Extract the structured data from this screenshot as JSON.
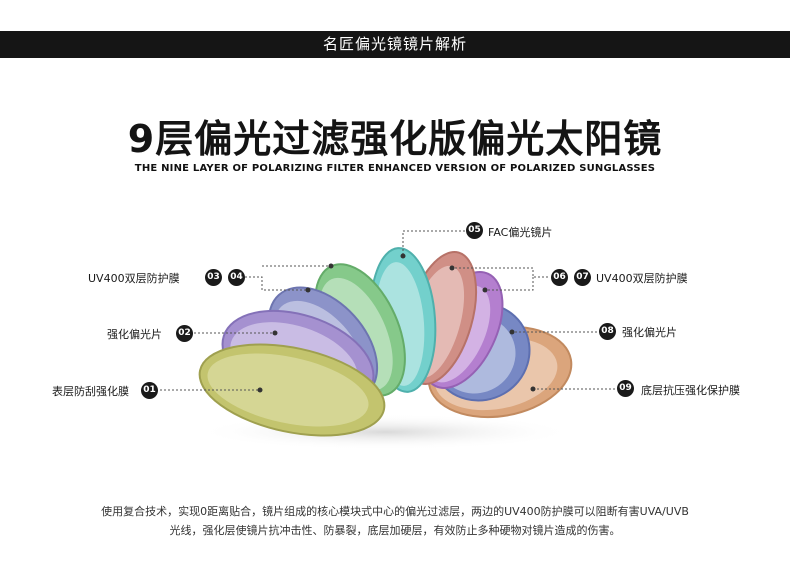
{
  "header": {
    "title": "名匠偏光镜镜片解析"
  },
  "main_title": "9层偏光过滤强化版偏光太阳镜",
  "subtitle": "THE NINE LAYER OF POLARIZING FILTER ENHANCED VERSION OF POLARIZED SUNGLASSES",
  "layers": [
    {
      "num": "01",
      "name": "表层防刮强化膜",
      "color": "#c3c46e"
    },
    {
      "num": "02",
      "name": "强化偏光片",
      "color": "#a591d0"
    },
    {
      "num": "03",
      "name": "UV400双层防护膜",
      "color": "#8c93c9"
    },
    {
      "num": "04",
      "name": "UV400双层防护膜",
      "color": "#86c98a"
    },
    {
      "num": "05",
      "name": "FAC偏光镜片",
      "color": "#73d0cc"
    },
    {
      "num": "06",
      "name": "UV400双层防护膜",
      "color": "#d08f86"
    },
    {
      "num": "07",
      "name": "UV400双层防护膜",
      "color": "#b47fcf"
    },
    {
      "num": "08",
      "name": "强化偏光片",
      "color": "#7788c4"
    },
    {
      "num": "09",
      "name": "底层抗压强化保护膜",
      "color": "#dba57c"
    }
  ],
  "callouts": {
    "label_01": "表层防刮强化膜",
    "label_02": "强化偏光片",
    "label_03_04": "UV400双层防护膜",
    "label_05": "FAC偏光镜片",
    "label_06_07": "UV400双层防护膜",
    "label_08": "强化偏光片",
    "label_09": "底层抗压强化保护膜"
  },
  "description": {
    "line1": "使用复合技术，实现0距离贴合，镜片组成的核心模块式中心的偏光过滤层，两边的UV400防护膜可以阻断有害UVA/UVB",
    "line2": "光线，强化层使镜片抗冲击性、防暴裂，底层加硬层，有效防止多种硬物对镜片造成的伤害。"
  }
}
